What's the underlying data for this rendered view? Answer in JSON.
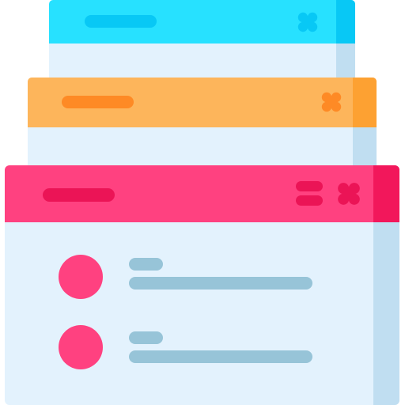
{
  "colors": {
    "background": "#ffffff",
    "window_body": "#e3f2fd",
    "window_body_shade": "#c0def1",
    "back_bar": "#27e1ff",
    "back_bar_shade": "#08c8f5",
    "back_accent": "#08c8f5",
    "middle_bar": "#fdb55b",
    "middle_bar_shade": "#fda132",
    "middle_accent": "#fe8a25",
    "front_bar": "#ff4180",
    "front_bar_shade": "#f2175b",
    "front_accent": "#eb1456",
    "avatar": "#ff4180",
    "text_line": "#97c4d8"
  },
  "icons": {
    "back_window_close": "close-icon",
    "middle_window_close": "close-icon",
    "front_window_menu": "menu-icon",
    "front_window_close": "close-icon"
  },
  "front_window": {
    "list_items": 2
  }
}
